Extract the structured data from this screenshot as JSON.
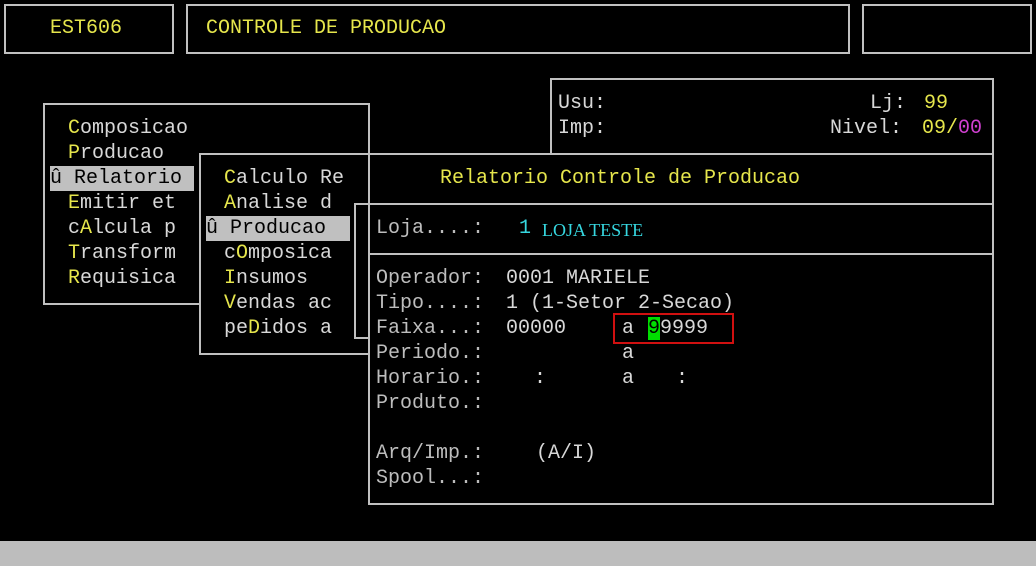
{
  "header": {
    "program_code": "EST606",
    "title": "CONTROLE DE PRODUCAO",
    "right_box": ""
  },
  "user_info": {
    "usu_label": "Usu:",
    "imp_label": "Imp:",
    "lj_label": "Lj:",
    "lj_value": "99",
    "nivel_label": "Nivel:",
    "nivel_value": "09/",
    "nivel_value2": "00"
  },
  "menu1": {
    "items": [
      {
        "prefix": " ",
        "hot": "C",
        "rest": "omposicao"
      },
      {
        "prefix": " ",
        "hot": "P",
        "rest": "roducao"
      },
      {
        "prefix": "û ",
        "hot": "R",
        "rest": "elatorio"
      },
      {
        "prefix": " ",
        "hot": "E",
        "rest": "mitir et"
      },
      {
        "prefix": " c",
        "hot": "A",
        "rest": "lcula p"
      },
      {
        "prefix": " ",
        "hot": "T",
        "rest": "ransform"
      },
      {
        "prefix": " ",
        "hot": "R",
        "rest": "equisica"
      }
    ]
  },
  "menu2": {
    "items": [
      {
        "prefix": " ",
        "hot": "C",
        "rest": "alculo Re"
      },
      {
        "prefix": " ",
        "hot": "A",
        "rest": "nalise d"
      },
      {
        "prefix": "û ",
        "hot": "P",
        "rest": "roducao"
      },
      {
        "prefix": " c",
        "hot": "O",
        "rest": "mposica"
      },
      {
        "prefix": " ",
        "hot": "I",
        "rest": "nsumos"
      },
      {
        "prefix": " ",
        "hot": "V",
        "rest": "endas ac"
      },
      {
        "prefix": " pe",
        "hot": "D",
        "rest": "idos a"
      }
    ]
  },
  "dialog": {
    "title": "Relatorio Controle de Producao",
    "loja_label": "Loja....:",
    "loja_code": "1",
    "loja_name": "LOJA TESTE",
    "operador_label": "Operador:",
    "operador_value": "0001 MARIELE",
    "tipo_label": "Tipo....:",
    "tipo_value": "1 (1-Setor 2-Secao)",
    "faixa_label": "Faixa...:",
    "faixa_from": "00000",
    "faixa_sep": "a",
    "faixa_to_cursor": "9",
    "faixa_to_rest": "9999",
    "periodo_label": "Periodo.:",
    "periodo_sep": "a",
    "horario_label": "Horario.:",
    "horario_colon1": ":",
    "horario_sep": "a",
    "horario_colon2": ":",
    "produto_label": "Produto.:",
    "arq_label": "Arq/Imp.:",
    "arq_hint": "(A/I)",
    "spool_label": "Spool...:"
  }
}
